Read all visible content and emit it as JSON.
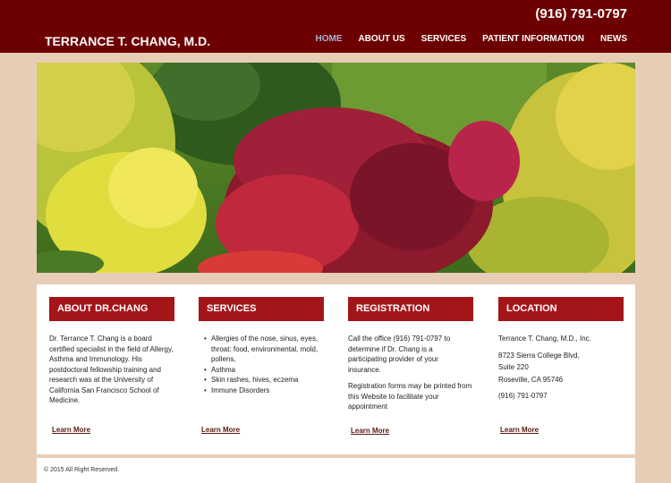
{
  "header": {
    "phone": "(916) 791-0797",
    "logo": "TERRANCE T. CHANG, M.D.",
    "nav": [
      "HOME",
      "ABOUT US",
      "SERVICES",
      "PATIENT INFORMATION",
      "NEWS"
    ],
    "active_nav": "HOME"
  },
  "colors": {
    "topbar": "#6d0000",
    "accent": "#a4151a",
    "page_bg": "#e8cdb6"
  },
  "columns": {
    "about": {
      "title": "ABOUT DR.CHANG",
      "text": "Dr. Terrance T. Chang is a board certified specialist in the field of Allergy, Asthma and Immunology. His postdoctoral fellowship training and research was at the University of California San Francisco School of Medicine.",
      "link": "Learn More"
    },
    "services": {
      "title": "SERVICES",
      "items": [
        "Allergies of the nose, sinus, eyes, throat: food, environmental, mold, pollens,",
        "Asthma",
        "Skin rashes, hives, eczema",
        "Immune Disorders"
      ],
      "link": "Learn More"
    },
    "registration": {
      "title": "REGISTRATION",
      "text1": "Call the office (916) 791-0797 to determine if Dr. Chang is a participating provider of your insurance.",
      "text2": "Registration forms may be printed from this Website to facilitate your appointment",
      "link": "Learn More"
    },
    "location": {
      "title": "LOCATION",
      "name": "Terrance T. Chang, M.D., Inc.",
      "street": "8723 Sierra College Blvd,",
      "suite": "Suite 220",
      "city": "Roseville, CA 95746",
      "phone": "(916) 791-0797",
      "link": "Learn More"
    }
  },
  "footer": {
    "copyright": "© 2015 All Right Reserved."
  }
}
